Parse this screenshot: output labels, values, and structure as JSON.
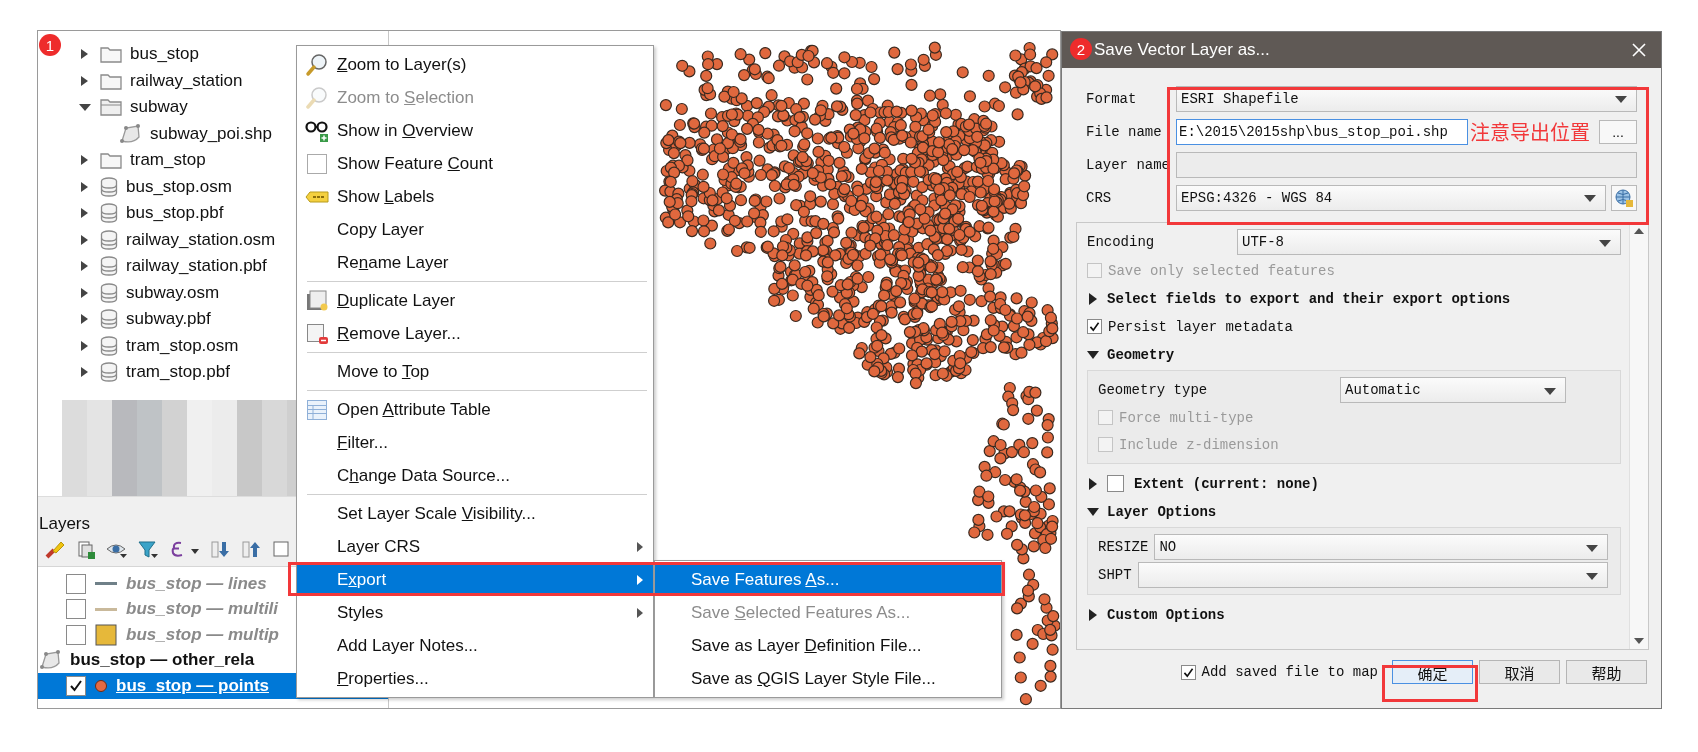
{
  "browser_panel": {
    "badge": "1",
    "items": [
      {
        "label": "bus_stop",
        "kind": "folder",
        "expanded": false
      },
      {
        "label": "railway_station",
        "kind": "folder",
        "expanded": false
      },
      {
        "label": "subway",
        "kind": "folder",
        "expanded": true,
        "children": [
          {
            "label": "subway_poi.shp",
            "kind": "vector"
          }
        ]
      },
      {
        "label": "tram_stop",
        "kind": "folder",
        "expanded": false
      },
      {
        "label": "bus_stop.osm",
        "kind": "database",
        "expanded": false
      },
      {
        "label": "bus_stop.pbf",
        "kind": "database",
        "expanded": false
      },
      {
        "label": "railway_station.osm",
        "kind": "database",
        "expanded": false
      },
      {
        "label": "railway_station.pbf",
        "kind": "database",
        "expanded": false
      },
      {
        "label": "subway.osm",
        "kind": "database",
        "expanded": false
      },
      {
        "label": "subway.pbf",
        "kind": "database",
        "expanded": false
      },
      {
        "label": "tram_stop.osm",
        "kind": "database",
        "expanded": false
      },
      {
        "label": "tram_stop.pbf",
        "kind": "database",
        "expanded": false
      }
    ]
  },
  "layers_panel": {
    "title": "Layers",
    "layers": [
      {
        "label": "bus_stop — lines",
        "kind": "line",
        "color": "#6f8088",
        "checked": false,
        "empty": true,
        "selected": false
      },
      {
        "label": "bus_stop — multili",
        "kind": "line",
        "color": "#c9b99b",
        "checked": false,
        "empty": true,
        "selected": false
      },
      {
        "label": "bus_stop — multip",
        "kind": "polygon",
        "color": "#e6b83a",
        "checked": false,
        "empty": true,
        "selected": false
      },
      {
        "label": "bus_stop — other_rela",
        "kind": "geometryless",
        "empty": false,
        "selected": false
      },
      {
        "label": "bus_stop — points",
        "kind": "point",
        "color": "#e46a43",
        "checked": true,
        "empty": false,
        "selected": true
      }
    ]
  },
  "context_menu": {
    "items": [
      {
        "key": "Z",
        "post": "oom to Layer(s)",
        "kind": "zoom",
        "disabled": false,
        "selected": false,
        "submenu": false,
        "separator_before": false
      },
      {
        "pre": "Zoom to ",
        "key": "S",
        "post": "election",
        "kind": "zoom",
        "disabled": true,
        "selected": false,
        "submenu": false,
        "separator_before": false
      },
      {
        "pre": "Show in ",
        "key": "O",
        "post": "verview",
        "kind": "overview",
        "disabled": false,
        "selected": false,
        "submenu": false,
        "separator_before": false
      },
      {
        "pre": "Show Feature ",
        "key": "C",
        "post": "ount",
        "kind": "toggle",
        "checked": false,
        "disabled": false,
        "selected": false,
        "submenu": false,
        "separator_before": false
      },
      {
        "pre": "Show ",
        "key": "L",
        "post": "abels",
        "kind": "labels",
        "disabled": false,
        "selected": false,
        "submenu": false,
        "separator_before": false
      },
      {
        "pre": "Copy Layer",
        "kind": "plain",
        "disabled": false,
        "selected": false,
        "submenu": false,
        "separator_before": false
      },
      {
        "pre": "Re",
        "key": "n",
        "post": "ame Layer",
        "kind": "plain",
        "disabled": false,
        "selected": false,
        "submenu": false,
        "separator_before": false
      },
      {
        "key": "D",
        "post": "uplicate Layer",
        "kind": "duplicate",
        "disabled": false,
        "selected": false,
        "submenu": false,
        "separator_before": true
      },
      {
        "key": "R",
        "post": "emove Layer...",
        "kind": "remove",
        "disabled": false,
        "selected": false,
        "submenu": false,
        "separator_before": false
      },
      {
        "pre": "Move to ",
        "key": "T",
        "post": "op",
        "kind": "plain",
        "disabled": false,
        "selected": false,
        "submenu": false,
        "separator_before": true
      },
      {
        "pre": "Open ",
        "key": "A",
        "post": "ttribute Table",
        "kind": "table",
        "disabled": false,
        "selected": false,
        "submenu": false,
        "separator_before": true
      },
      {
        "key": "F",
        "post": "ilter...",
        "kind": "plain",
        "disabled": false,
        "selected": false,
        "submenu": false,
        "separator_before": false
      },
      {
        "pre": "C",
        "key": "h",
        "post": "ange Data Source...",
        "kind": "plain",
        "disabled": false,
        "selected": false,
        "submenu": false,
        "separator_before": false
      },
      {
        "pre": "Set Layer Scale ",
        "key": "V",
        "post": "isibility...",
        "kind": "plain",
        "disabled": false,
        "selected": false,
        "submenu": false,
        "separator_before": true
      },
      {
        "pre": "Layer CRS",
        "kind": "plain",
        "disabled": false,
        "selected": false,
        "submenu": true,
        "separator_before": false
      },
      {
        "pre": "E",
        "key": "x",
        "post": "port",
        "kind": "plain",
        "disabled": false,
        "selected": true,
        "submenu": true,
        "separator_before": false
      },
      {
        "pre": "Styles",
        "kind": "plain",
        "disabled": false,
        "selected": false,
        "submenu": true,
        "separator_before": false
      },
      {
        "pre": "Add Layer Notes...",
        "kind": "plain",
        "disabled": false,
        "selected": false,
        "submenu": false,
        "separator_before": false
      },
      {
        "key": "P",
        "post": "roperties...",
        "kind": "plain",
        "disabled": false,
        "selected": false,
        "submenu": false,
        "separator_before": false
      }
    ]
  },
  "export_submenu": {
    "items": [
      {
        "pre": "Save Features ",
        "key": "A",
        "post": "s...",
        "disabled": false,
        "selected": true
      },
      {
        "pre": "Save ",
        "key": "S",
        "post": "elected Features As...",
        "disabled": true,
        "selected": false
      },
      {
        "pre": "Save as Layer ",
        "key": "D",
        "post": "efinition File...",
        "disabled": false,
        "selected": false
      },
      {
        "pre": "Save as ",
        "key": "Q",
        "post": "GIS Layer Style File...",
        "disabled": false,
        "selected": false
      }
    ]
  },
  "dialog": {
    "badge": "2",
    "title": "Save Vector Layer as...",
    "fields": [
      {
        "label": "Format",
        "kind": "dropdown",
        "value": "ESRI Shapefile"
      },
      {
        "label": "File name",
        "kind": "file",
        "value": "E:\\2015\\2015shp\\bus_stop_poi.shp",
        "note": "注意导出位置",
        "button": "..."
      },
      {
        "label": "Layer name",
        "kind": "text",
        "disabled": true
      },
      {
        "label": "CRS",
        "kind": "crs",
        "value": "EPSG:4326 - WGS 84"
      }
    ],
    "options": [
      {
        "kind": "dropdown",
        "label": "Encoding",
        "value": "UTF-8"
      },
      {
        "kind": "checkbox",
        "label": "Save only selected features",
        "checked": false,
        "disabled": true
      },
      {
        "kind": "section",
        "label": "Select fields to export and their export options",
        "expanded": false
      },
      {
        "kind": "checkbox",
        "label": "Persist layer metadata",
        "checked": true,
        "disabled": false
      },
      {
        "kind": "section",
        "label": "Geometry",
        "expanded": true,
        "children": [
          {
            "kind": "dropdown",
            "label": "Geometry type",
            "value": "Automatic"
          },
          {
            "kind": "checkbox",
            "label": "Force multi-type",
            "checked": false,
            "disabled": true
          },
          {
            "kind": "checkbox",
            "label": "Include z-dimension",
            "checked": false,
            "disabled": true
          }
        ]
      },
      {
        "kind": "section",
        "label": "Extent (current: none)",
        "expanded": false,
        "checked": false
      },
      {
        "kind": "section",
        "label": "Layer Options",
        "expanded": true,
        "children": [
          {
            "kind": "dropdown",
            "label": "RESIZE",
            "value": "NO"
          },
          {
            "kind": "dropdown",
            "label": "SHPT"
          }
        ]
      },
      {
        "kind": "section",
        "label": "Custom Options",
        "expanded": false
      }
    ],
    "add_to_map": {
      "label": "Add saved file to map",
      "checked": true
    },
    "buttons": [
      {
        "label": "确定",
        "default": true
      },
      {
        "label": "取消",
        "default": false
      },
      {
        "label": "帮助",
        "default": false
      }
    ]
  }
}
